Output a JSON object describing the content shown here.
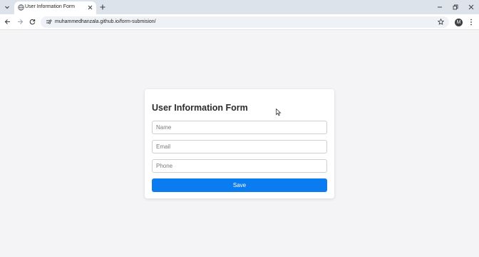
{
  "browser": {
    "tab_title": "User Information Form",
    "url": "muhammedhanzala.github.io/form-submision/",
    "profile_initial": "M"
  },
  "form": {
    "title": "User Information Form",
    "name_placeholder": "Name",
    "email_placeholder": "Email",
    "phone_placeholder": "Phone",
    "save_label": "Save"
  },
  "colors": {
    "accent": "#0b7bf0",
    "page_background": "#f4f4f6",
    "tabbar": "#dde3ea"
  },
  "icons": [
    "tab-search-icon",
    "globe-icon",
    "close-icon",
    "plus-icon",
    "minimize-icon",
    "restore-icon",
    "back-arrow-icon",
    "forward-arrow-icon",
    "reload-icon",
    "site-info-icon",
    "star-icon",
    "more-vert-icon",
    "cursor-icon"
  ]
}
